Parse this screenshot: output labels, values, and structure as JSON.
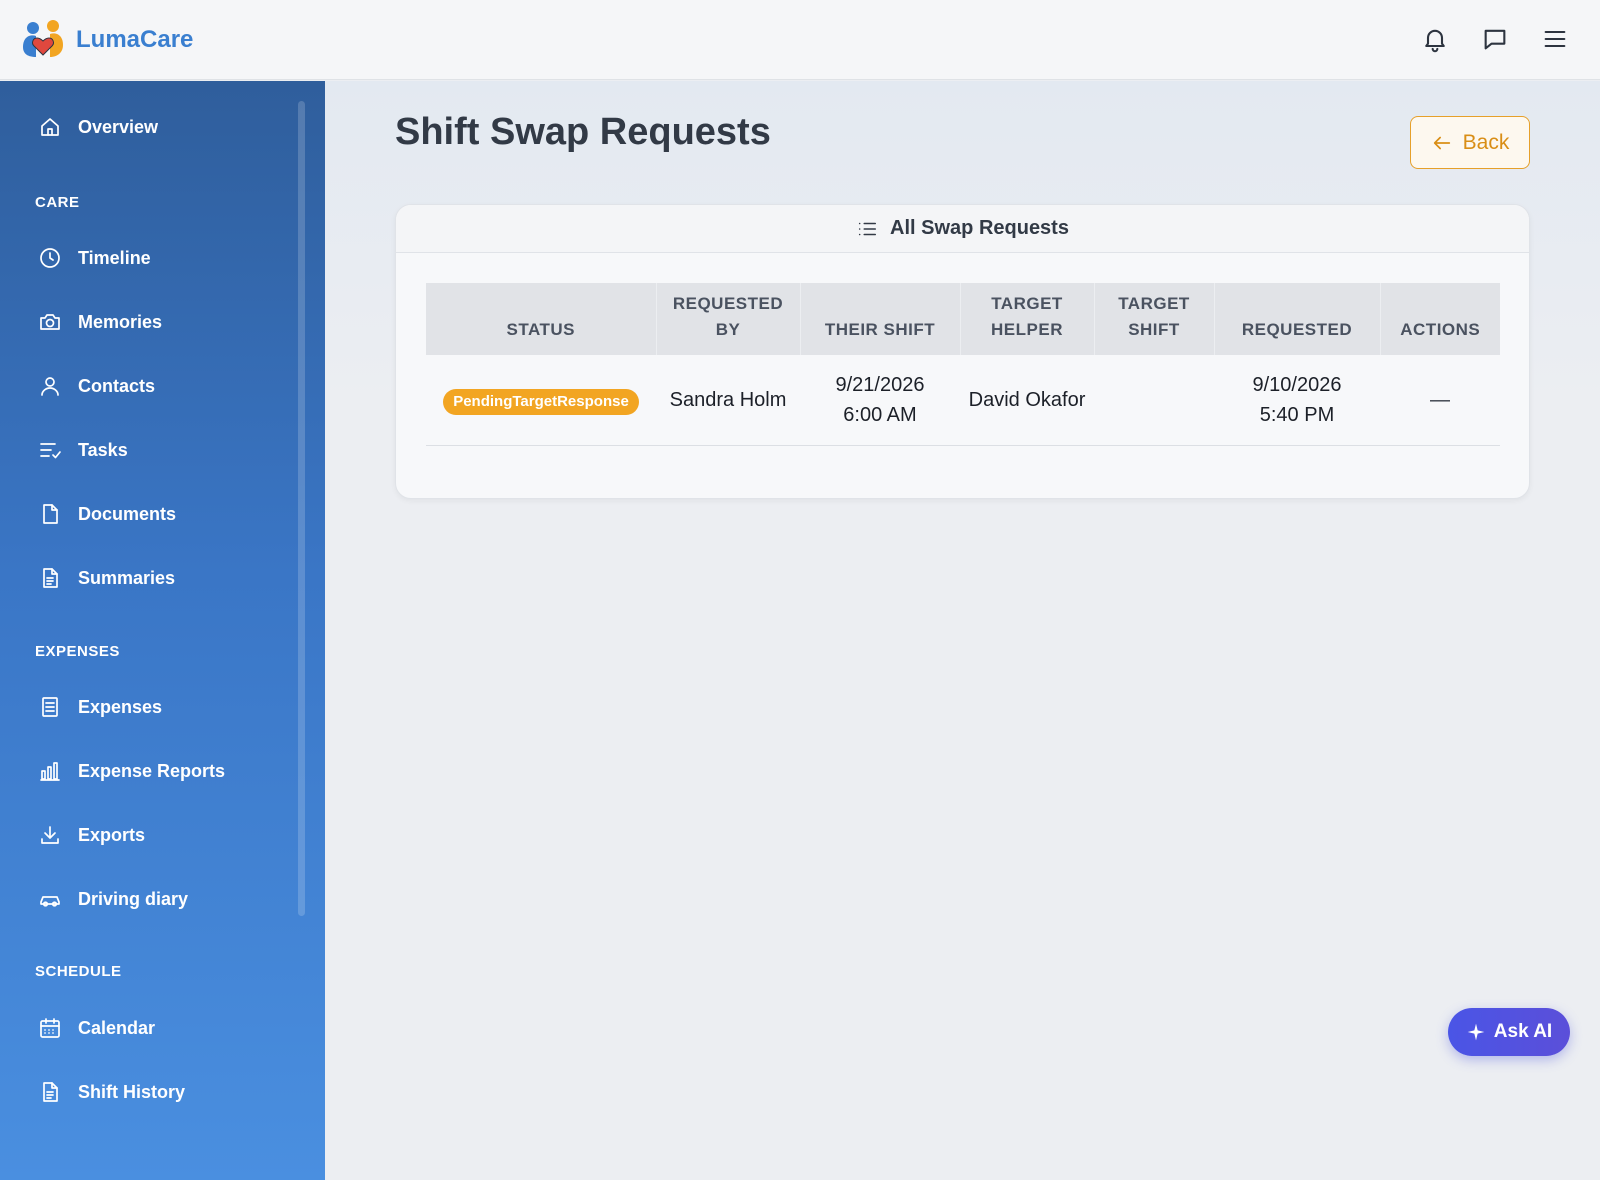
{
  "app": {
    "name": "LumaCare"
  },
  "topbar": {
    "icons": [
      "bell-icon",
      "chat-icon",
      "menu-icon"
    ]
  },
  "sidebar": {
    "items": [
      {
        "label": "Overview",
        "icon": "home-icon"
      }
    ],
    "sections": [
      {
        "title": "CARE",
        "items": [
          {
            "label": "Timeline",
            "icon": "clock-icon"
          },
          {
            "label": "Memories",
            "icon": "camera-icon"
          },
          {
            "label": "Contacts",
            "icon": "user-icon"
          },
          {
            "label": "Tasks",
            "icon": "tasks-icon"
          },
          {
            "label": "Documents",
            "icon": "document-icon"
          },
          {
            "label": "Summaries",
            "icon": "summary-icon"
          }
        ]
      },
      {
        "title": "EXPENSES",
        "items": [
          {
            "label": "Expenses",
            "icon": "receipt-icon"
          },
          {
            "label": "Expense Reports",
            "icon": "bar-chart-icon"
          },
          {
            "label": "Exports",
            "icon": "download-icon"
          },
          {
            "label": "Driving diary",
            "icon": "car-icon"
          }
        ]
      },
      {
        "title": "SCHEDULE",
        "items": [
          {
            "label": "Calendar",
            "icon": "calendar-icon"
          },
          {
            "label": "Shift History",
            "icon": "history-icon"
          }
        ]
      }
    ]
  },
  "page": {
    "title": "Shift Swap Requests",
    "back_label": "Back"
  },
  "card": {
    "title": "All Swap Requests",
    "columns": [
      "Status",
      "Requested by",
      "Their Shift",
      "Target Helper",
      "Target Shift",
      "Requested",
      "Actions"
    ],
    "rows": [
      {
        "status": "PendingTargetResponse",
        "requested_by": "Sandra Holm",
        "their_shift_date": "9/21/2026",
        "their_shift_time": "6:00 AM",
        "target_helper": "David Okafor",
        "target_shift": "",
        "requested_date": "9/10/2026",
        "requested_time": "5:40 PM",
        "actions": "—"
      }
    ]
  },
  "ask_ai": {
    "label": "Ask AI"
  },
  "colors": {
    "brand": "#3a7fd0",
    "badge": "#f2a522",
    "back_accent": "#d98e16",
    "ask_ai": "#4a55e6"
  }
}
